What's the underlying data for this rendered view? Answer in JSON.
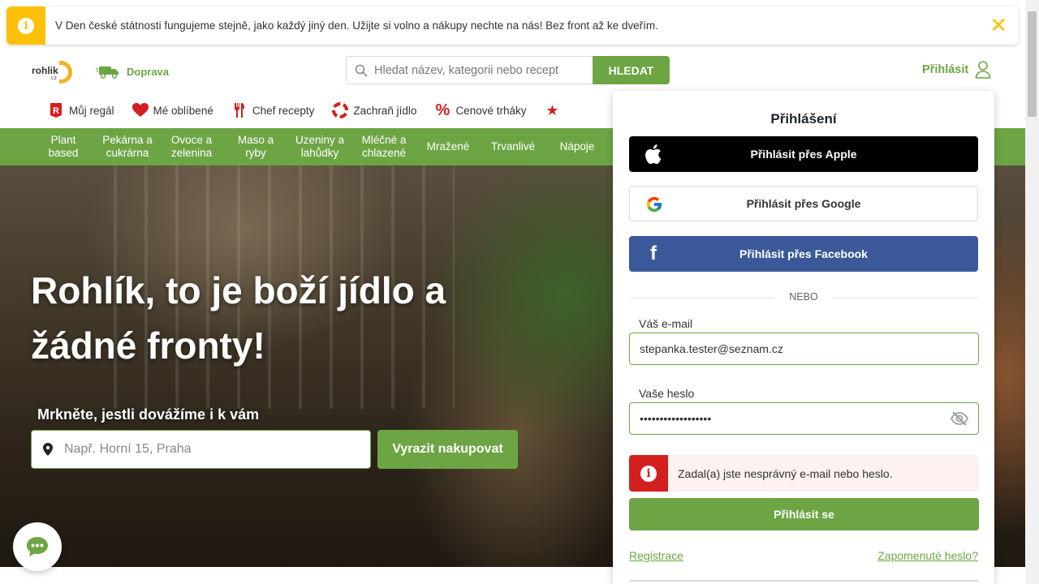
{
  "notice": {
    "text": "V Den české státnosti fungujeme stejně, jako každý jiný den. Užijte si volno a nákupy nechte na nás! Bez front až ke dveřím.",
    "icon": "info-icon",
    "close_icon": "close-icon"
  },
  "header": {
    "logo_text": "rohlik",
    "logo_suffix": ".cz",
    "delivery_label": "Doprava",
    "search": {
      "placeholder": "Hledat název, kategorii nebo recept",
      "button_label": "HLEDAT"
    },
    "login_label": "Přihlásit"
  },
  "topnav": [
    {
      "label": "Můj regál",
      "icon": "shelf-icon"
    },
    {
      "label": "Mé oblíbené",
      "icon": "heart-icon"
    },
    {
      "label": "Chef recepty",
      "icon": "fork-knife-icon"
    },
    {
      "label": "Zachraň jídlo",
      "icon": "lifebuoy-icon"
    },
    {
      "label": "Cenové trháky",
      "icon": "percent-icon"
    }
  ],
  "categories": [
    {
      "label": "Plant based"
    },
    {
      "label": "Pekárna a cukrárna"
    },
    {
      "label": "Ovoce a zelenina"
    },
    {
      "label": "Maso a ryby"
    },
    {
      "label": "Uzeniny a lahůdky"
    },
    {
      "label": "Mléčné a chlazené"
    },
    {
      "label": "Mražené"
    },
    {
      "label": "Trvanlivé"
    },
    {
      "label": "Nápoje"
    }
  ],
  "hero": {
    "title": "Rohlík, to je boží jídlo a žádné fronty!",
    "subtitle": "Mrkněte, jestli dovážíme i k vám",
    "address_placeholder": "Např. Horní 15, Praha",
    "button_label": "Vyrazit nakupovat"
  },
  "login_panel": {
    "title": "Přihlášení",
    "apple_label": "Přihlásit přes Apple",
    "google_label": "Přihlásit přes Google",
    "facebook_label": "Přihlásit přes Facebook",
    "or_label": "NEBO",
    "email_label": "Váš e-mail",
    "email_value": "stepanka.tester@seznam.cz",
    "password_label": "Vaše heslo",
    "password_value": "secretpassword1234",
    "error_text": "Zadal(a) jste nesprávný e-mail nebo heslo.",
    "submit_label": "Přihlásit se",
    "register_label": "Registrace",
    "forgot_label": "Zapomenuté heslo?"
  },
  "colors": {
    "brand_green": "#6da544",
    "notice_yellow": "#ffc107",
    "error_red": "#d41f1f",
    "facebook_blue": "#3b5998"
  }
}
